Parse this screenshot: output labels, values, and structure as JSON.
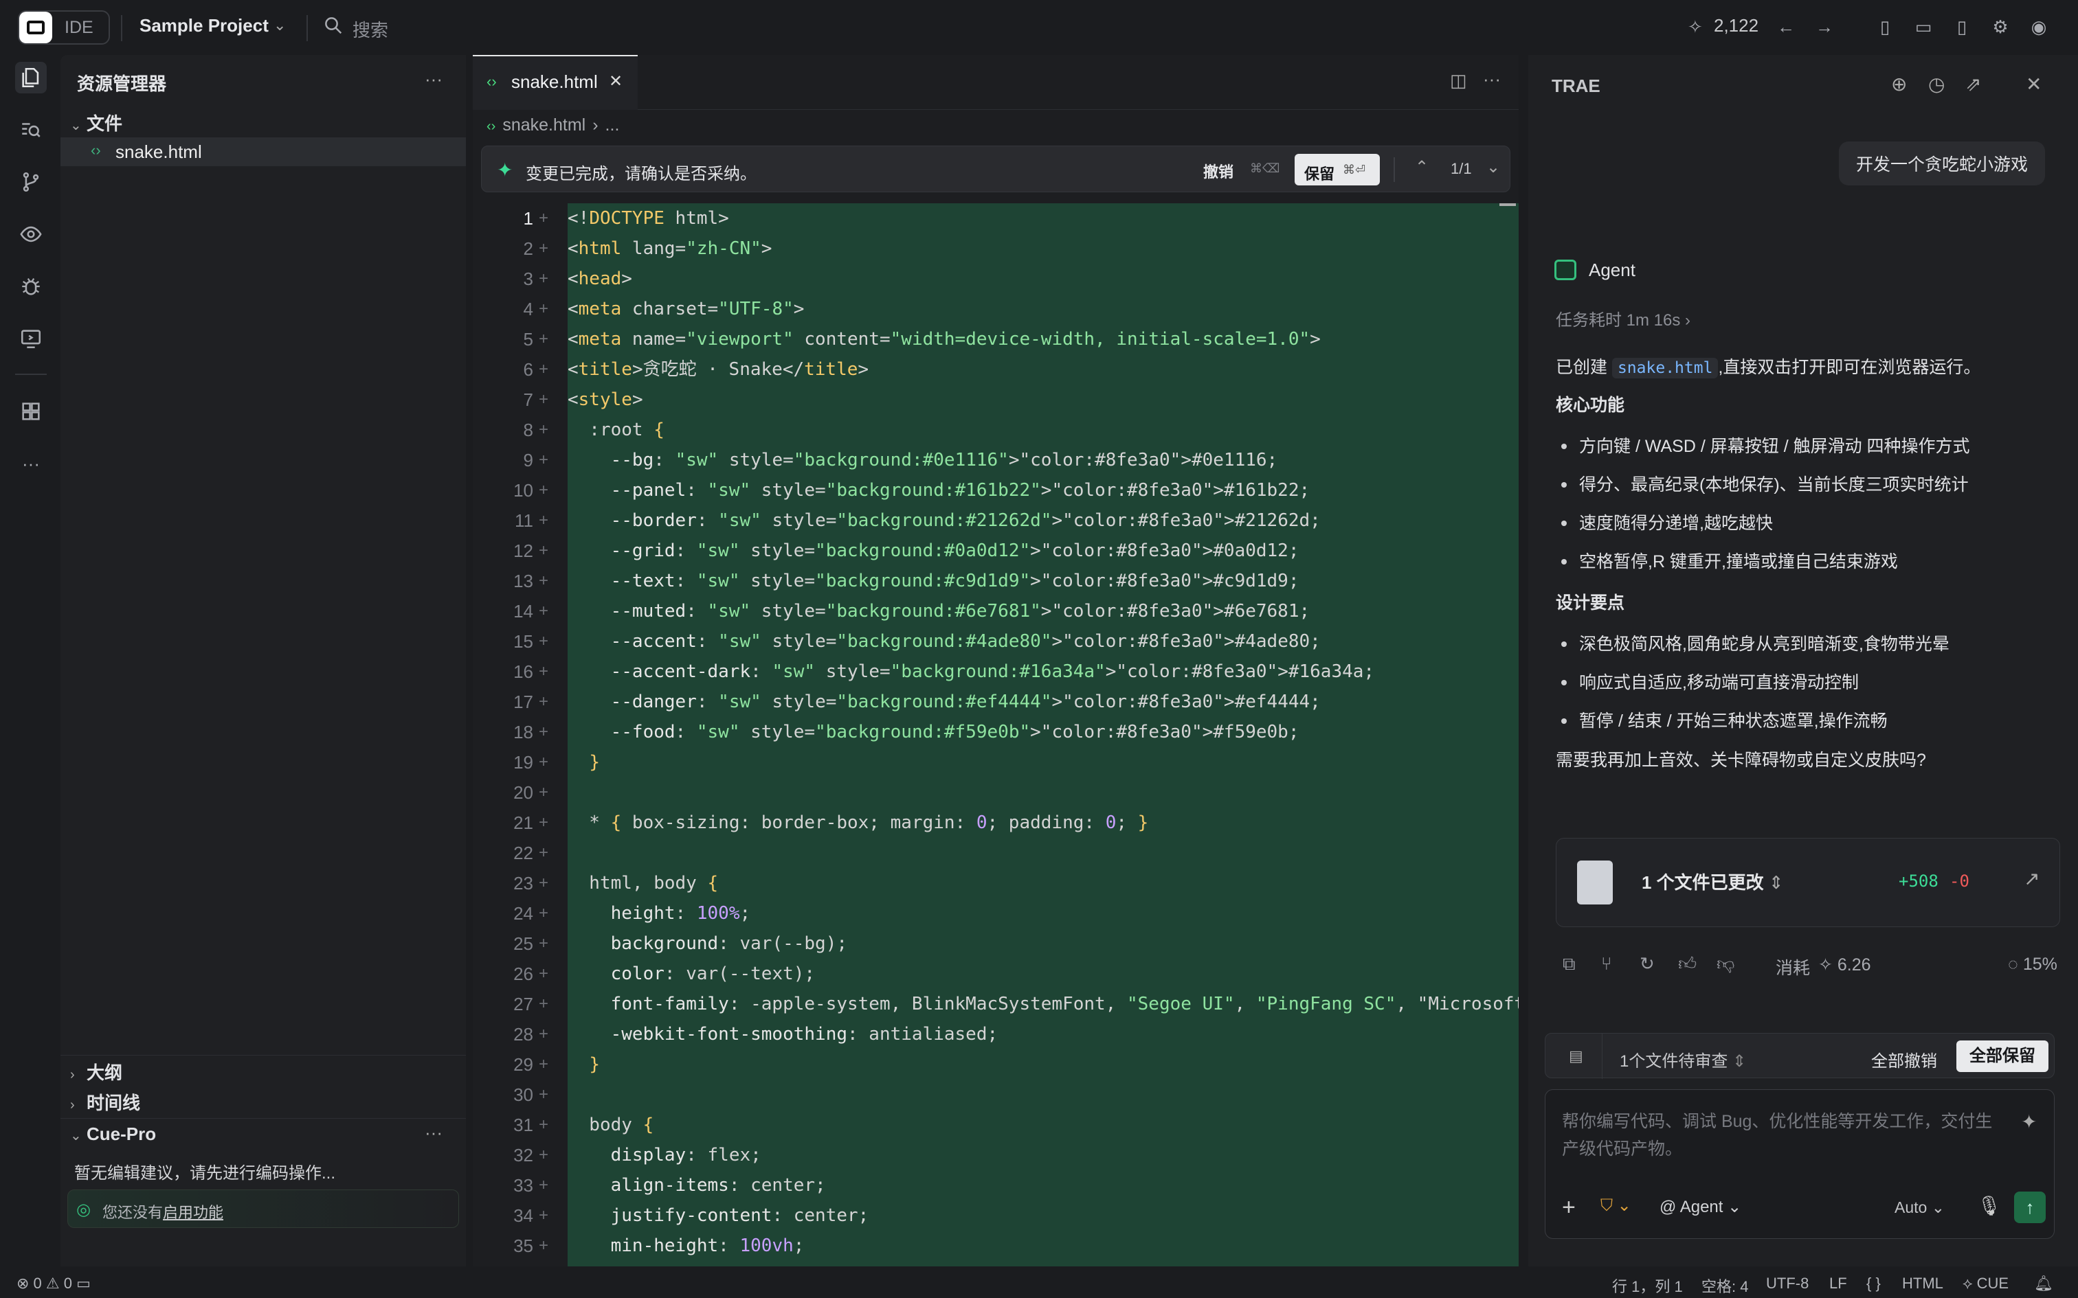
{
  "topbar": {
    "ide_label": "IDE",
    "project_name": "Sample Project",
    "search_label": "搜索",
    "credits": "2,122"
  },
  "explorer": {
    "title": "资源管理器",
    "folder_label": "文件",
    "file_name": "snake.html",
    "outline_label": "大纲",
    "timeline_label": "时间线",
    "cue_title": "Cue-Pro",
    "cue_hint": "暂无编辑建议，请先进行编码操作...",
    "cue_notice_prefix": "您还没有",
    "cue_notice_link": "启用功能"
  },
  "editor": {
    "tab_name": "snake.html",
    "breadcrumb_file": "snake.html",
    "breadcrumb_more": "...",
    "review_message": "变更已完成，请确认是否采纳。",
    "undo_label": "撤销",
    "undo_shortcut": "⌘⌫",
    "keep_label": "保留",
    "keep_shortcut": "⌘⏎",
    "change_counter": "1/1"
  },
  "code_lines": [
    "<!DOCTYPE html>",
    "<html lang=\"zh-CN\">",
    "<head>",
    "<meta charset=\"UTF-8\">",
    "<meta name=\"viewport\" content=\"width=device-width, initial-scale=1.0\">",
    "<title>贪吃蛇 · Snake</title>",
    "<style>",
    "  :root {",
    "    --bg: #0e1116;",
    "    --panel: #161b22;",
    "    --border: #21262d;",
    "    --grid: #0a0d12;",
    "    --text: #c9d1d9;",
    "    --muted: #6e7681;",
    "    --accent: #4ade80;",
    "    --accent-dark: #16a34a;",
    "    --danger: #ef4444;",
    "    --food: #f59e0b;",
    "  }",
    "",
    "  * { box-sizing: border-box; margin: 0; padding: 0; }",
    "",
    "  html, body {",
    "    height: 100%;",
    "    background: var(--bg);",
    "    color: var(--text);",
    "    font-family: -apple-system, BlinkMacSystemFont, \"Segoe UI\", \"PingFang SC\", \"Microsoft",
    "    -webkit-font-smoothing: antialiased;",
    "  }",
    "",
    "  body {",
    "    display: flex;",
    "    align-items: center;",
    "    justify-content: center;",
    "    min-height: 100vh;"
  ],
  "chat": {
    "title": "TRAE",
    "user_message": "开发一个贪吃蛇小游戏",
    "agent_name": "Agent",
    "task_time": "任务耗时 1m 16s",
    "intro_code": "snake.html",
    "intro_text": ",直接双击打开即可在浏览器运行。",
    "intro_prefix": "已创建 ",
    "core_heading": "核心功能",
    "core_items": [
      "方向键 / WASD / 屏幕按钮 / 触屏滑动 四种操作方式",
      "得分、最高纪录(本地保存)、当前长度三项实时统计",
      "速度随得分递增,越吃越快",
      "空格暂停,R 键重开,撞墙或撞自己结束游戏"
    ],
    "design_heading": "设计要点",
    "design_items": [
      "深色极简风格,圆角蛇身从亮到暗渐变,食物带光晕",
      "响应式自适应,移动端可直接滑动控制",
      "暂停 / 结束 / 开始三种状态遮罩,操作流畅"
    ],
    "question": "需要我再加上音效、关卡障碍物或自定义皮肤吗?",
    "files_changed": "1 个文件已更改",
    "additions": "+508",
    "deletions": "-0",
    "cost_label": "消耗",
    "cost_value": "6.26",
    "context_pct": "15%",
    "pending_label": "1个文件待审查",
    "reject_all": "全部撤销",
    "keep_all": "全部保留",
    "input_placeholder": "帮你编写代码、调试 Bug、优化性能等开发工作，交付生产级代码产物。",
    "mode_label": "@ Agent",
    "model_label": "Auto"
  },
  "status": {
    "errors": "0",
    "warnings": "0",
    "position": "行 1，列 1",
    "spaces": "空格: 4",
    "encoding": "UTF-8",
    "eol": "LF",
    "braces": "{ }",
    "language": "HTML",
    "cue": "CUE"
  },
  "colors": {
    "accent": "#4ade80",
    "diff_bg": "#1e4434",
    "keyword": "#f3c969",
    "tag": "#f3c969",
    "string": "#8fe3a0",
    "value": "#c8a0ff"
  }
}
